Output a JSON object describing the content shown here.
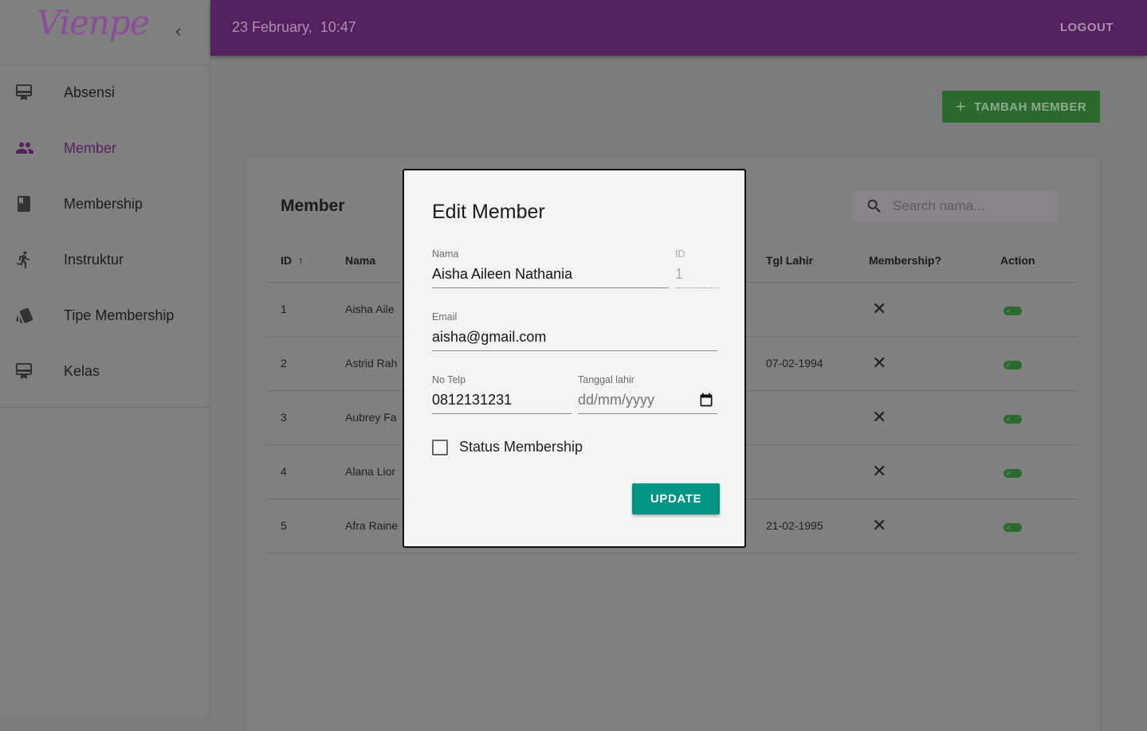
{
  "app": {
    "brand": "Vienpe",
    "accent": "#55205f"
  },
  "header": {
    "datetime": "23 February,  10:47",
    "logout": "LOGOUT"
  },
  "sidebar": {
    "items": [
      {
        "label": "Absensi",
        "icon": "card-membership-icon"
      },
      {
        "label": "Member",
        "icon": "people-icon",
        "active": true
      },
      {
        "label": "Membership",
        "icon": "book-icon"
      },
      {
        "label": "Instruktur",
        "icon": "running-icon"
      },
      {
        "label": "Tipe Membership",
        "icon": "style-cards-icon"
      },
      {
        "label": "Kelas",
        "icon": "card-membership-icon"
      }
    ]
  },
  "main": {
    "add_button": "TAMBAH MEMBER",
    "card_title": "Member",
    "search_placeholder": "Search nama...",
    "columns": [
      "ID",
      "Nama",
      "Tgl Lahir",
      "Membership?",
      "Action"
    ],
    "rows": [
      {
        "id": "1",
        "nama": "Aisha Aile",
        "tgl": "",
        "membership": "✕"
      },
      {
        "id": "2",
        "nama": "Astrid Rah",
        "tgl": "07-02-1994",
        "membership": "✕"
      },
      {
        "id": "3",
        "nama": "Aubrey Fa",
        "tgl": "",
        "membership": "✕"
      },
      {
        "id": "4",
        "nama": "Alana Lior",
        "tgl": "",
        "membership": "✕"
      },
      {
        "id": "5",
        "nama": "Afra Raine",
        "tgl": "21-02-1995",
        "membership": "✕"
      }
    ]
  },
  "modal": {
    "title": "Edit Member",
    "nama_label": "Nama",
    "nama_value": "Aisha Aileen Nathania",
    "id_label": "ID",
    "id_value": "1",
    "email_label": "Email",
    "email_value": "aisha@gmail.com",
    "telp_label": "No Telp",
    "telp_value": "0812131231",
    "tgl_label": "Tanggal lahir",
    "tgl_placeholder": "dd/mm/yyyy",
    "status_label": "Status Membership",
    "status_checked": false,
    "update": "UPDATE"
  }
}
